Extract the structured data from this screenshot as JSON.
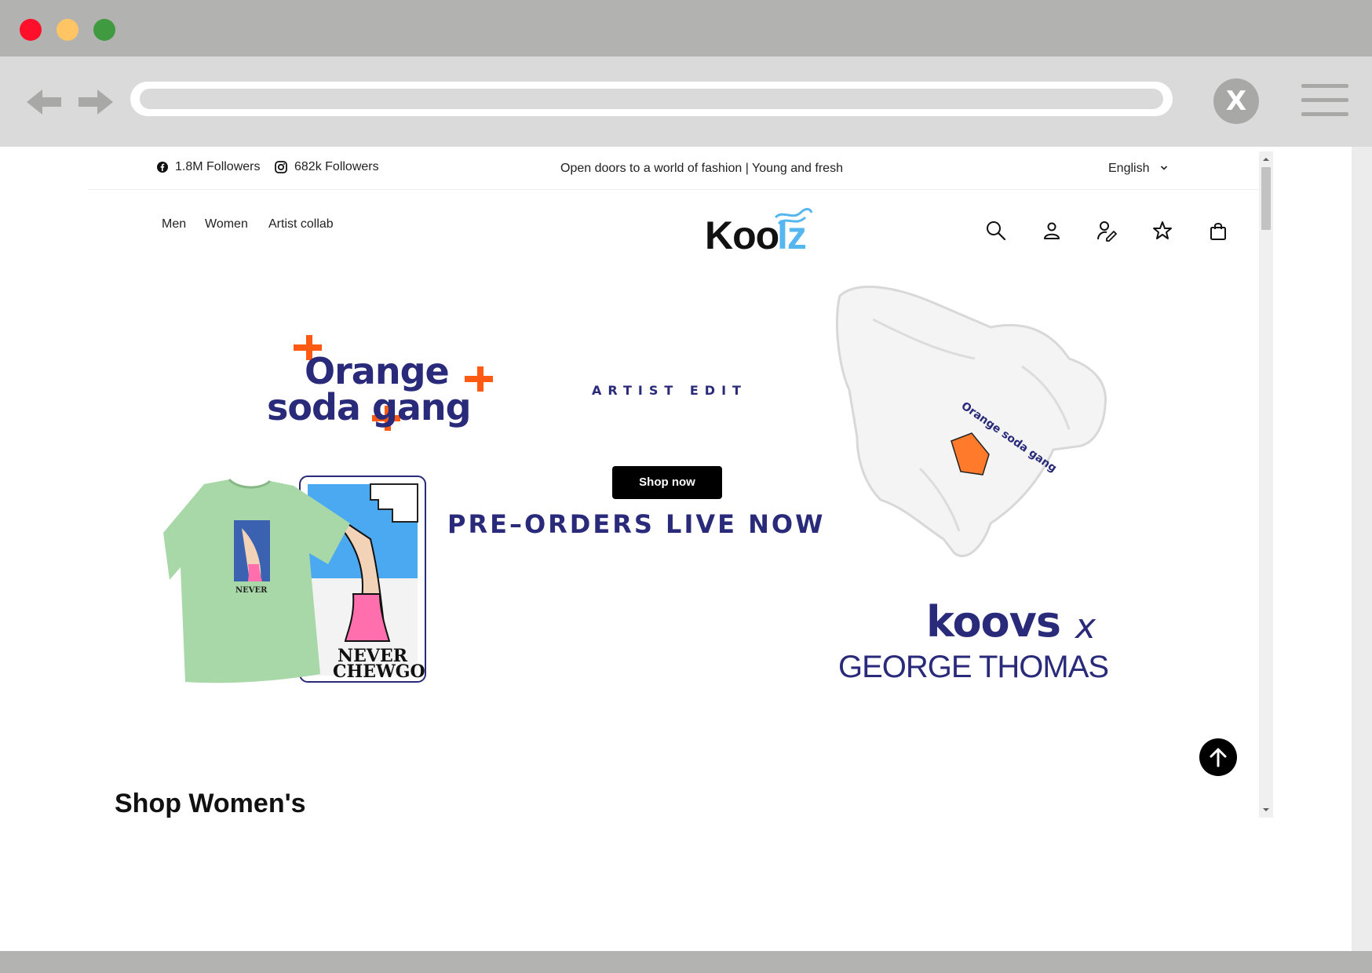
{
  "window": {
    "controls": [
      "close-dot",
      "minimize-dot",
      "maximize-dot"
    ]
  },
  "browser": {
    "back_icon": "arrow-left-icon",
    "forward_icon": "arrow-right-icon",
    "url": "",
    "close_label": "X",
    "menu_icon": "hamburger-icon"
  },
  "topbar": {
    "facebook_followers": "1.8M Followers",
    "instagram_followers": "682k Followers",
    "tagline": "Open doors to a world of fashion | Young and fresh",
    "language": "English"
  },
  "nav": {
    "links": [
      "Men",
      "Women",
      "Artist collab"
    ],
    "logo": "Koolz",
    "icons": [
      "search-icon",
      "user-icon",
      "user-edit-icon",
      "star-icon",
      "bag-icon"
    ]
  },
  "hero": {
    "brand_line1": "Orange",
    "brand_line2": "soda gang",
    "edit_label": "ARTIST EDIT",
    "cta": "Shop now",
    "headline": "PRE–ORDERS LIVE NOW",
    "collab_line1": "koovs",
    "collab_x": "x",
    "collab_line2": "GEORGE THOMAS",
    "tee_print": "NEVER",
    "card_text": "NEVER",
    "card_text2": "CHEWGO",
    "jacket_print": "Orange soda gang",
    "colors": {
      "navy": "#2a2a7a",
      "orange": "#ff5a14",
      "tee_green": "#a8d8a8"
    }
  },
  "section": {
    "title": "Shop Women's"
  }
}
